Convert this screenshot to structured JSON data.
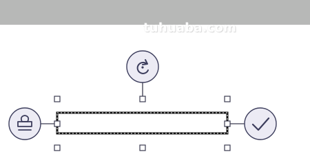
{
  "watermark": {
    "text": "tuhuaba.com"
  },
  "colors": {
    "top_bar": "#b7b8b7",
    "icon_stroke": "#3c3d5c",
    "icon_fill": "#ecebf4",
    "handle_stroke": "#3b3b4f",
    "box_border": "#111111"
  },
  "controls": {
    "rotate": {
      "icon": "rotate-icon"
    },
    "stamp": {
      "icon": "stamp-icon"
    },
    "confirm": {
      "icon": "checkmark-icon"
    }
  }
}
